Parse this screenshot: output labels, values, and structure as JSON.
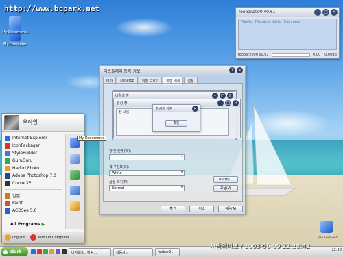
{
  "watermark_url": "http://www.bcpark.net",
  "desktop_icons": [
    {
      "label": "My Computer"
    },
    {
      "label": "My Documents"
    },
    {
      "label": "Recycle Bin"
    }
  ],
  "foobar": {
    "title": "foobar2000 v0.61",
    "status_left": "foobar2000 v0.61",
    "status_time": "0.00",
    "status_total": "0.00dB",
    "list_row": [
      "Playlist",
      "Filename",
      "Artist",
      "Comment"
    ]
  },
  "display_dialog": {
    "title": "디스플레이 등록 정보",
    "tabs": [
      "테마",
      "Desktop",
      "화면 보호기",
      "화면 배색",
      "설정"
    ],
    "active_tab": "화면 배색",
    "label_color_scheme": "창 및 단추(W):",
    "label_font_color": "색 구성표(C):",
    "color_value": "White",
    "label_font_size": "글꼴 크기(F):",
    "font_value": "Normal",
    "effects_button": "효과(E)...",
    "advanced_button": "고급(V)",
    "ok_button": "확인",
    "cancel_button": "취소",
    "apply_button": "적용(A)"
  },
  "sub_window_1": {
    "title": "비활성 창"
  },
  "sub_window_2": {
    "title": "활성 창",
    "list_item": "창 내용"
  },
  "message_box": {
    "title": "메시지 상자",
    "ok": "확인"
  },
  "start_menu": {
    "user": "우아앙",
    "pinned": [
      {
        "label": "Internet Explorer",
        "color": "#2b6fd6"
      },
      {
        "label": "IconPackager",
        "color": "#d8342c"
      },
      {
        "label": "StyleBuilder",
        "color": "#3c7bd4"
      },
      {
        "label": "GuruGuru",
        "color": "#3aa45a"
      },
      {
        "label": "Haduri Photo",
        "color": "#e0a12c"
      },
      {
        "label": "Adobe Photoshop 7.0",
        "color": "#1c4c8c"
      },
      {
        "label": "CursorXP",
        "color": "#333333"
      }
    ],
    "recent": [
      {
        "label": "알집",
        "color": "#c97b22"
      },
      {
        "label": "Paint",
        "color": "#d14f3a"
      },
      {
        "label": "ACDSee 5.0",
        "color": "#2f62c4"
      }
    ],
    "all_programs": "All Programs",
    "tooltip": "My Documents",
    "log_off": "Log Off",
    "turn_off": "Turn Off Computer"
  },
  "taskbar": {
    "start": "start",
    "tasks": [
      "바자회으 : 바탕...",
      "잡동사니",
      "foobar2..."
    ],
    "time": "22:28"
  },
  "stamp": "사랑의바보 / 2003-06-09 22:28:42"
}
